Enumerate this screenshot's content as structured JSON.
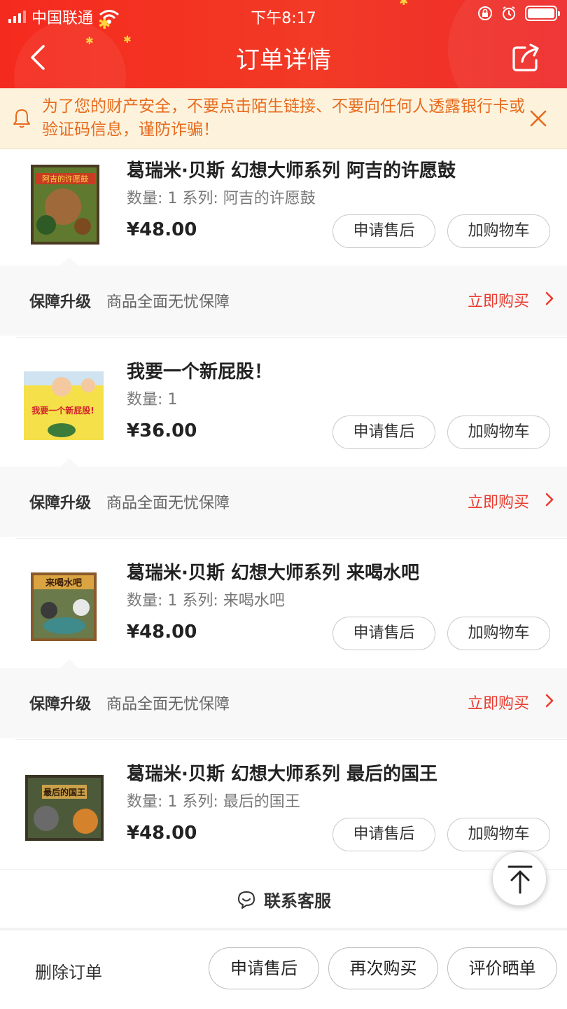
{
  "status_bar": {
    "carrier": "中国联通",
    "time": "下午8:17"
  },
  "nav": {
    "title": "订单详情"
  },
  "notice": {
    "text": "为了您的财产安全，不要点击陌生链接、不要向任何人透露银行卡或验证码信息，谨防诈骗！"
  },
  "items": [
    {
      "title": "葛瑞米·贝斯 幻想大师系列 阿吉的许愿鼓",
      "meta": "数量: 1 系列: 阿吉的许愿鼓",
      "price": "¥48.00",
      "cover_text": "阿吉的许愿鼓"
    },
    {
      "title": "我要一个新屁股！",
      "meta": "数量: 1",
      "price": "¥36.00",
      "cover_text": "我要一个新屁股!"
    },
    {
      "title": "葛瑞米·贝斯 幻想大师系列 来喝水吧",
      "meta": "数量: 1 系列: 来喝水吧",
      "price": "¥48.00",
      "cover_text": "来喝水吧"
    },
    {
      "title": "葛瑞米·贝斯 幻想大师系列 最后的国王",
      "meta": "数量: 1 系列: 最后的国王",
      "price": "¥48.00",
      "cover_text": "最后的国王"
    }
  ],
  "item_buttons": {
    "after_sale": "申请售后",
    "add_cart": "加购物车"
  },
  "guarantee": {
    "label": "保障升级",
    "desc": "商品全面无忧保障",
    "buy": "立即购买"
  },
  "contact": {
    "label": "联系客服"
  },
  "bottom_bar": {
    "delete": "删除订单",
    "after_sale": "申请售后",
    "rebuy": "再次购买",
    "review": "评价晒单"
  },
  "colors": {
    "header_red": "#f23a26",
    "notice_bg": "#fdf3dd",
    "notice_text": "#e76b1e",
    "accent_red": "#e93b2f"
  }
}
